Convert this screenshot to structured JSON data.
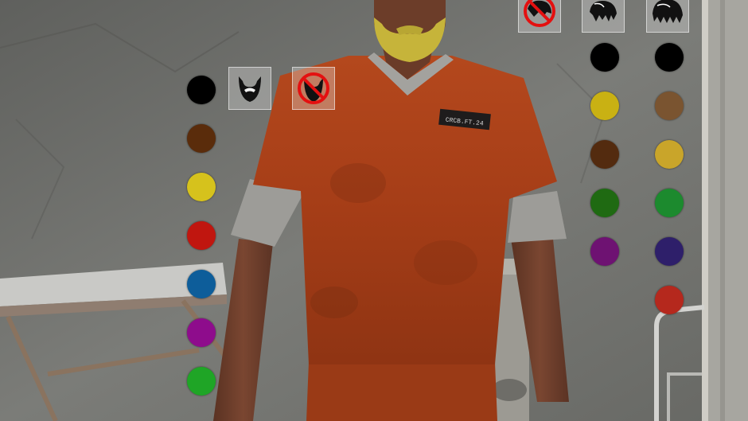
{
  "customizer": {
    "beard_panel": {
      "options": [
        {
          "icon": "beard-icon"
        },
        {
          "icon": "no-beard-icon"
        }
      ],
      "colors": [
        "#000000",
        "#5a2c0b",
        "#d6c21c",
        "#c0160f",
        "#0d5d9a",
        "#8e0c8c",
        "#1fa526"
      ]
    },
    "hair_panel": {
      "options": [
        {
          "icon": "no-hair-icon"
        },
        {
          "icon": "hair-short-icon"
        },
        {
          "icon": "hair-long-icon"
        }
      ],
      "colors_a": [
        "#000000",
        "#c9b113",
        "#532b0f",
        "#1f6a12",
        "#6e1272"
      ],
      "colors_b": [
        "#000000",
        "#7a5430",
        "#c9a52a",
        "#1c8a2e",
        "#2e1f6a",
        "#b5281d"
      ]
    },
    "character": {
      "shirt_badge": "CRCB.FT.24"
    }
  }
}
